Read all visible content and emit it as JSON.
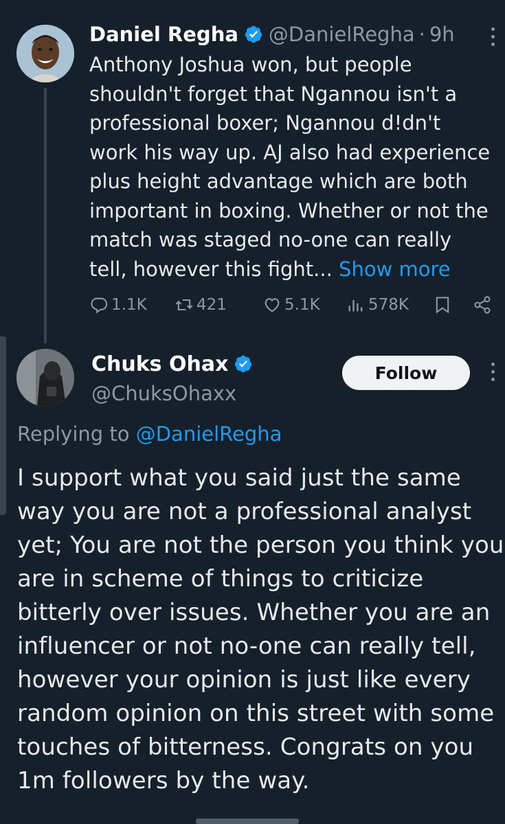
{
  "tweet": {
    "author_name": "Daniel Regha",
    "author_handle": "@DanielRegha",
    "separator": "·",
    "time": "9h",
    "text": "Anthony Joshua won, but people shouldn't forget that Ngannou isn't a professional boxer; Ngannou d!dn't work his way up. AJ also had experience plus height advantage which are both important in boxing. Whether or not the match was staged no-one can really tell, however this fight...",
    "show_more": "Show more",
    "stats": {
      "replies": "1.1K",
      "retweets": "421",
      "likes": "5.1K",
      "views": "578K"
    }
  },
  "reply": {
    "author_name": "Chuks Ohax",
    "author_handle": "@ChuksOhaxx",
    "follow_label": "Follow",
    "replying_prefix": "Replying to",
    "replying_to": "@DanielRegha",
    "text": "I support what you said just the same way you are not a professional analyst yet; You are not the person you think you are in scheme of things to criticize bitterly over issues. Whether you are an influencer or not no-one can really tell, however your opinion is just like every random opinion on this street with some touches of bitterness. Congrats on you 1m followers by the way."
  },
  "icons": [
    "verified-badge-icon",
    "reply-icon",
    "retweet-icon",
    "like-icon",
    "views-icon",
    "bookmark-icon",
    "share-icon",
    "more-icon"
  ],
  "colors": {
    "background": "#15202b",
    "text": "#e7e9ea",
    "secondary": "#8b98a5",
    "accent": "#1d9bf0",
    "follow_bg": "#eff3f4"
  }
}
